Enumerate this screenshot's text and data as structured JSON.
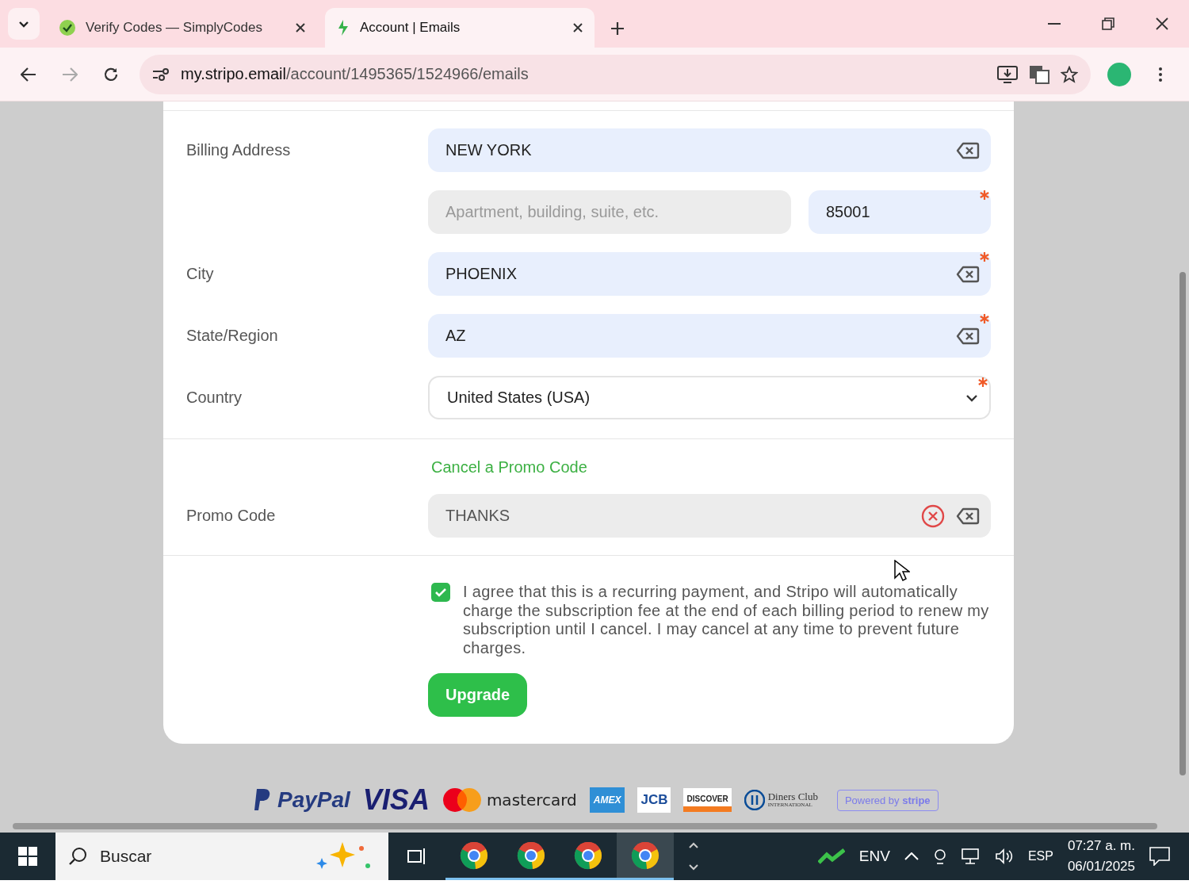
{
  "browser": {
    "tabs": [
      {
        "title": "Verify Codes — SimplyCodes",
        "kind": "simplycodes",
        "selected": false
      },
      {
        "title": "Account | Emails",
        "kind": "stripo",
        "selected": true
      }
    ],
    "url_host": "my.stripo.email",
    "url_path": "/account/1495365/1524966/emails"
  },
  "address_rows": [
    {
      "label": "Billing Address",
      "fields": [
        {
          "kind": "text",
          "value": "NEW YORK",
          "required": false,
          "clearable": true
        }
      ]
    },
    {
      "fields": [
        {
          "kind": "text",
          "placeholder": "Apartment, building, suite, etc.",
          "required": false,
          "clearable": false
        },
        {
          "kind": "text",
          "value": "85001",
          "required": true,
          "clearable": false
        }
      ]
    },
    {
      "label": "City",
      "fields": [
        {
          "kind": "text",
          "value": "PHOENIX",
          "required": true,
          "clearable": true
        }
      ]
    },
    {
      "label": "State/Region",
      "fields": [
        {
          "kind": "text",
          "value": "AZ",
          "required": true,
          "clearable": true
        }
      ]
    },
    {
      "label": "Country",
      "fields": [
        {
          "kind": "select",
          "value": "United States (USA)",
          "required": true,
          "clearable": false
        }
      ]
    }
  ],
  "promo": {
    "link": "Cancel a Promo Code",
    "label": "Promo Code",
    "value": "THANKS"
  },
  "agreement": {
    "checked": true,
    "text": "I agree that this is a recurring payment, and Stripo will automatically charge the subscription fee at the end of each billing period to renew my subscription until I cancel. I may cancel at any time to prevent future charges."
  },
  "submit": "Upgrade",
  "payment_logos": [
    {
      "kind": "paypal",
      "text": "PayPal"
    },
    {
      "kind": "visa",
      "text": "VISA"
    },
    {
      "kind": "mastercard",
      "text": "mastercard"
    },
    {
      "kind": "amex",
      "text": "AMEX"
    },
    {
      "kind": "jcb",
      "text": "JCB"
    },
    {
      "kind": "discover",
      "text": "DISCOVER"
    },
    {
      "kind": "diners",
      "text": "Diners Club",
      "subtext": "INTERNATIONAL"
    },
    {
      "kind": "stripe",
      "text": "Powered by",
      "brand": "stripe"
    }
  ],
  "taskbar": {
    "search": "Buscar",
    "apps": [
      {
        "selected": false
      },
      {
        "selected": false
      },
      {
        "selected": false
      },
      {
        "selected": true
      }
    ],
    "weather": "ENV",
    "language": "ESP",
    "time": "07:27 a. m.",
    "date": "06/01/2025"
  }
}
